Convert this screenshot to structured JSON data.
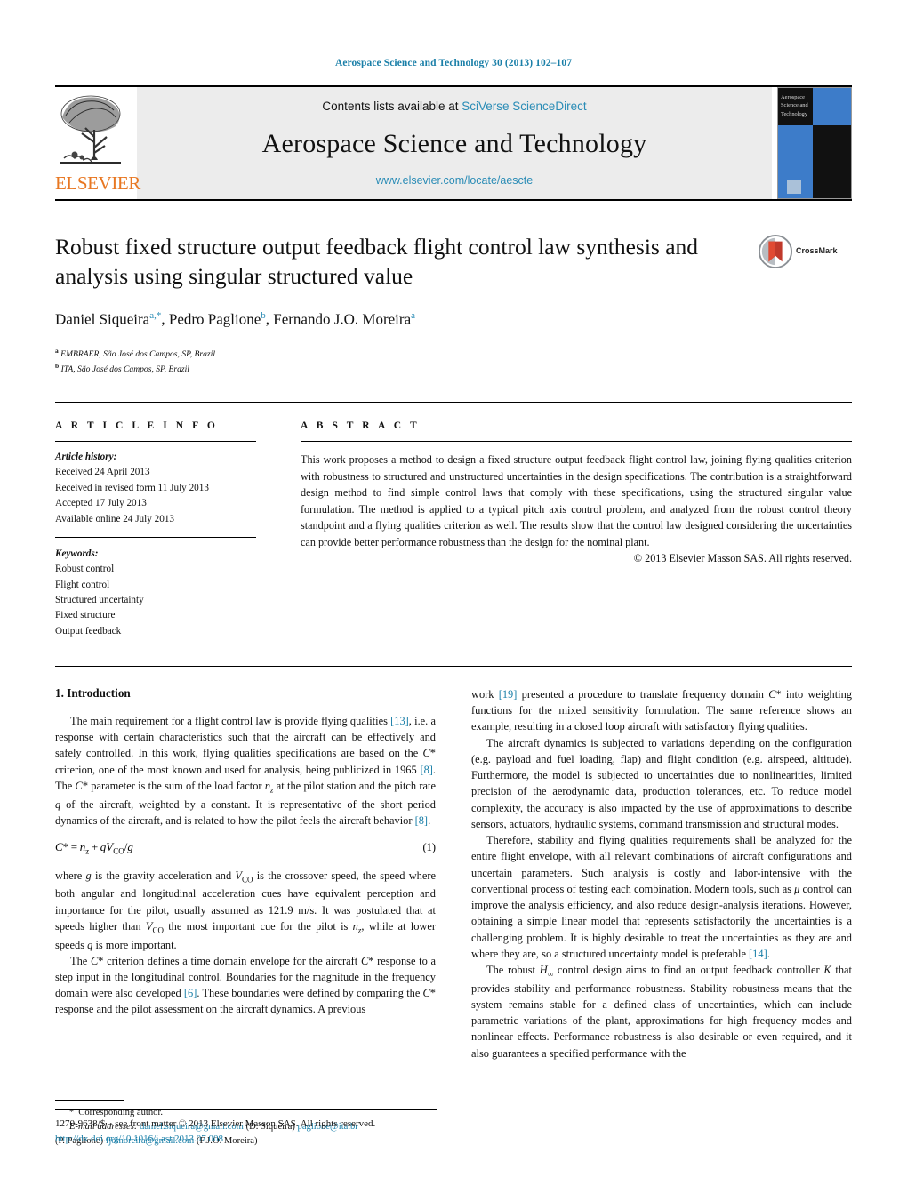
{
  "running_head": "Aerospace Science and Technology 30 (2013) 102–107",
  "masthead": {
    "publisher_name": "ELSEVIER",
    "contents_prefix": "Contents lists available at ",
    "contents_link": "SciVerse ScienceDirect",
    "journal_title": "Aerospace Science and Technology",
    "journal_url": "www.elsevier.com/locate/aescte",
    "cover_text": "Aerospace Science and Technology"
  },
  "article": {
    "title": "Robust fixed structure output feedback flight control law synthesis and analysis using singular structured value",
    "crossmark_label": "CrossMark",
    "authors_html": "Daniel Siqueira, Pedro Paglione, Fernando J.O. Moreira",
    "authors": [
      {
        "name": "Daniel Siqueira",
        "marks": "a,*"
      },
      {
        "name": "Pedro Paglione",
        "marks": "b"
      },
      {
        "name": "Fernando J.O. Moreira",
        "marks": "a"
      }
    ],
    "affiliations": [
      {
        "mark": "a",
        "text": "EMBRAER, São José dos Campos, SP, Brazil"
      },
      {
        "mark": "b",
        "text": "ITA, São José dos Campos, SP, Brazil"
      }
    ]
  },
  "info": {
    "heading": "A R T I C L E    I N F O",
    "history_label": "Article history:",
    "history": [
      "Received 24 April 2013",
      "Received in revised form 11 July 2013",
      "Accepted 17 July 2013",
      "Available online 24 July 2013"
    ],
    "keywords_label": "Keywords:",
    "keywords": [
      "Robust control",
      "Flight control",
      "Structured uncertainty",
      "Fixed structure",
      "Output feedback"
    ]
  },
  "abstract": {
    "heading": "A B S T R A C T",
    "text": "This work proposes a method to design a fixed structure output feedback flight control law, joining flying qualities criterion with robustness to structured and unstructured uncertainties in the design specifications. The contribution is a straightforward design method to find simple control laws that comply with these specifications, using the structured singular value formulation. The method is applied to a typical pitch axis control problem, and analyzed from the robust control theory standpoint and a flying qualities criterion as well. The results show that the control law designed considering the uncertainties can provide better performance robustness than the design for the nominal plant.",
    "copyright": "© 2013 Elsevier Masson SAS. All rights reserved."
  },
  "body": {
    "section_title": "1. Introduction",
    "left_p1_a": "The main requirement for a flight control law is provide flying qualities ",
    "left_p1_ref1": "[13]",
    "left_p1_b": ", i.e. a response with certain characteristics such that the aircraft can be effectively and safely controlled. In this work, flying qualities specifications are based on the ",
    "left_p1_c": " criterion, one of the most known and used for analysis, being publicized in 1965 ",
    "left_p1_ref2": "[8]",
    "left_p1_d": ". The ",
    "left_p1_e": " parameter is the sum of the load factor ",
    "left_p1_f": " at the pilot station and the pitch rate ",
    "left_p1_g": " of the aircraft, weighted by a constant. It is representative of the short period dynamics of the aircraft, and is related to how the pilot feels the aircraft behavior ",
    "left_p1_ref3": "[8]",
    "left_p1_h": ".",
    "equation": "C* = n_z + qV_CO/g",
    "equation_number": "(1)",
    "left_p2_a": "where ",
    "left_p2_b": " is the gravity acceleration and ",
    "left_p2_c": " is the crossover speed, the speed where both angular and longitudinal acceleration cues have equivalent perception and importance for the pilot, usually assumed as 121.9 m/s. It was postulated that at speeds higher than ",
    "left_p2_d": " the most important cue for the pilot is ",
    "left_p2_e": ", while at lower speeds ",
    "left_p2_f": " is more important.",
    "left_p3_a": "The ",
    "left_p3_b": " criterion defines a time domain envelope for the aircraft ",
    "left_p3_c": " response to a step input in the longitudinal control. Boundaries for the magnitude in the frequency domain were also developed ",
    "left_p3_ref": "[6]",
    "left_p3_d": ". These boundaries were defined by comparing the ",
    "left_p3_e": " response and the pilot assessment on the aircraft dynamics. A previous",
    "right_p1_a": "work ",
    "right_p1_ref": "[19]",
    "right_p1_b": " presented a procedure to translate frequency domain ",
    "right_p1_c": " into weighting functions for the mixed sensitivity formulation. The same reference shows an example, resulting in a closed loop aircraft with satisfactory flying qualities.",
    "right_p2": "The aircraft dynamics is subjected to variations depending on the configuration (e.g. payload and fuel loading, flap) and flight condition (e.g. airspeed, altitude). Furthermore, the model is subjected to uncertainties due to nonlinearities, limited precision of the aerodynamic data, production tolerances, etc. To reduce model complexity, the accuracy is also impacted by the use of approximations to describe sensors, actuators, hydraulic systems, command transmission and structural modes.",
    "right_p3_a": "Therefore, stability and flying qualities requirements shall be analyzed for the entire flight envelope, with all relevant combinations of aircraft configurations and uncertain parameters. Such analysis is costly and labor-intensive with the conventional process of testing each combination. Modern tools, such as ",
    "right_p3_b": " control can improve the analysis efficiency, and also reduce design-analysis iterations. However, obtaining a simple linear model that represents satisfactorily the uncertainties is a challenging problem. It is highly desirable to treat the uncertainties as they are and where they are, so a structured uncertainty model is preferable ",
    "right_p3_ref": "[14]",
    "right_p3_c": ".",
    "right_p4_a": "The robust ",
    "right_p4_b": " control design aims to find an output feedback controller ",
    "right_p4_c": " that provides stability and performance robustness. Stability robustness means that the system remains stable for a defined class of uncertainties, which can include parametric variations of the plant, approximations for high frequency modes and nonlinear effects. Performance robustness is also desirable or even required, and it also guarantees a specified performance with the"
  },
  "footnote": {
    "star": "*",
    "corresponding": "Corresponding author.",
    "email_label": "E-mail addresses:",
    "emails": [
      {
        "address": "daniel.siqueira@gmail.com",
        "owner": "(D. Siqueira)"
      },
      {
        "address": "paglione@ita.br",
        "owner": "(P. Paglione)"
      },
      {
        "address": "fjomoreira@gmail.com",
        "owner": "(F.J.O. Moreira)"
      }
    ]
  },
  "bottom": {
    "issn_line": "1270-9638/$ – see front matter © 2013 Elsevier Masson SAS. All rights reserved.",
    "doi": "http://dx.doi.org/10.1016/j.ast.2013.07.008"
  },
  "colors": {
    "accent_blue": "#1a7fa8",
    "link_blue": "#2a8cb6",
    "elsevier_orange": "#E87722",
    "cover_blue": "#3d7cc9"
  }
}
